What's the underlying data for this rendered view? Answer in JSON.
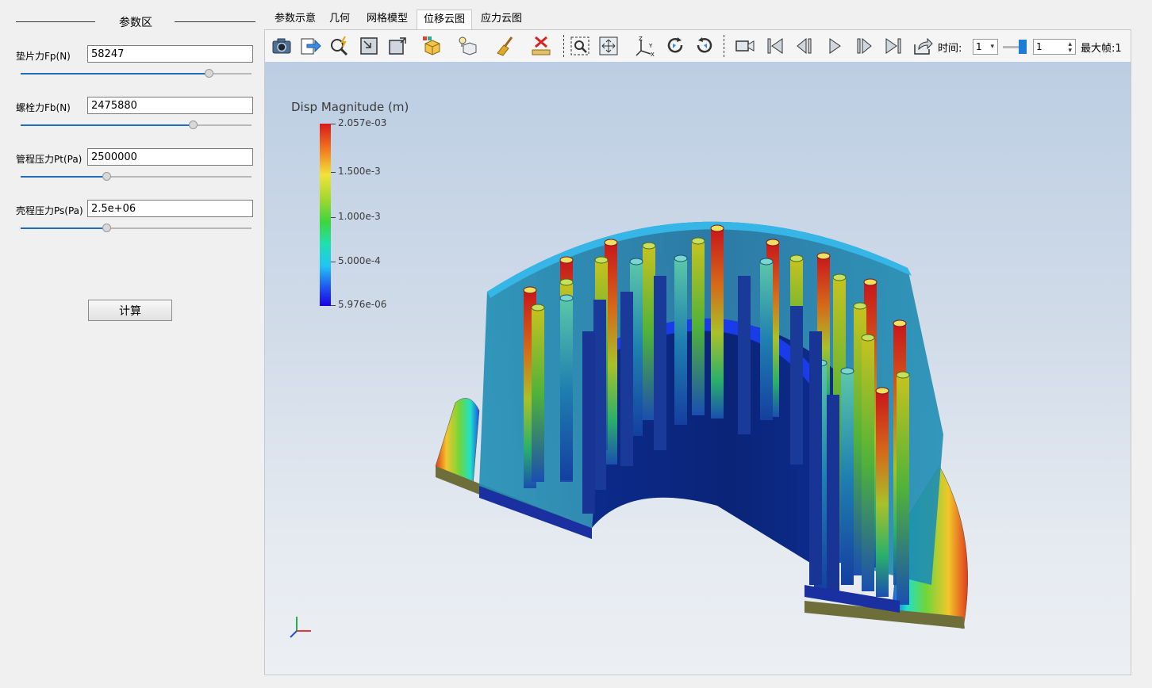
{
  "panel": {
    "title": "参数区",
    "params": [
      {
        "label": "垫片力Fp(N)",
        "value": "58247",
        "slider_fraction": 0.82
      },
      {
        "label": "螺栓力Fb(N)",
        "value": "2475880",
        "slider_fraction": 0.75
      },
      {
        "label": "管程压力Pt(Pa)",
        "value": "2500000",
        "slider_fraction": 0.37
      },
      {
        "label": "壳程压力Ps(Pa)",
        "value": "2.5e+06",
        "slider_fraction": 0.37
      }
    ],
    "calc_button": "计算"
  },
  "tabs": [
    {
      "label": "参数示意",
      "active": false
    },
    {
      "label": "几何",
      "active": false
    },
    {
      "label": "网格模型",
      "active": false
    },
    {
      "label": "位移云图",
      "active": true
    },
    {
      "label": "应力云图",
      "active": false
    }
  ],
  "toolbar": {
    "icons": [
      "camera-icon",
      "export-icon",
      "zoom-pick-icon",
      "fit-view-icon",
      "frame-icon",
      "solid-display-icon",
      "light-display-icon",
      "broom-icon",
      "ruler-delete-icon",
      "zoom-box-icon",
      "pan-icon",
      "axes-orient-icon",
      "rotate-cw-icon",
      "rotate-ccw-icon",
      "video-icon",
      "first-frame-icon",
      "prev-frame-icon",
      "play-icon",
      "next-frame-icon",
      "last-frame-icon",
      "export-anim-icon"
    ],
    "time_label": "时间:",
    "time_value": "1",
    "frame_value": "1",
    "max_frame_label": "最大帧:1"
  },
  "legend": {
    "title": "Disp Magnitude (m)",
    "max": "2.057e-03",
    "tick_1": "1.500e-3",
    "tick_2": "1.000e-3",
    "tick_3": "5.000e-4",
    "min": "5.976e-06"
  },
  "colors": {
    "accent": "#1d6ebf",
    "scale_red": "#d7191c",
    "scale_blue": "#1a00e0"
  }
}
